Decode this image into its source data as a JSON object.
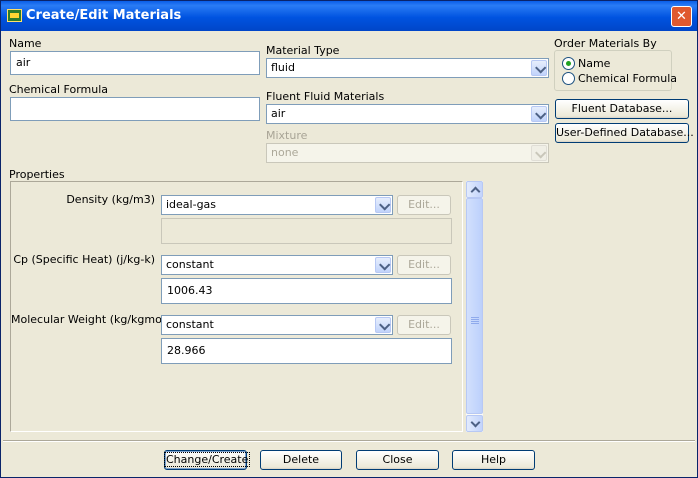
{
  "window": {
    "title": "Create/Edit Materials",
    "close_glyph": "✕"
  },
  "name": {
    "label": "Name",
    "value": "air"
  },
  "chemical_formula": {
    "label": "Chemical Formula",
    "value": ""
  },
  "material_type": {
    "label": "Material Type",
    "value": "fluid"
  },
  "fluent_fluid_materials": {
    "label": "Fluent Fluid Materials",
    "value": "air"
  },
  "mixture": {
    "label": "Mixture",
    "value": "none"
  },
  "order_by": {
    "label": "Order Materials By",
    "options": [
      {
        "label": "Name",
        "selected": true
      },
      {
        "label": "Chemical Formula",
        "selected": false
      }
    ]
  },
  "side_buttons": {
    "fluent_database": "Fluent Database...",
    "user_defined_database": "User-Defined Database..."
  },
  "properties": {
    "label": "Properties",
    "items": [
      {
        "label": "Density (kg/m3)",
        "method": "ideal-gas",
        "edit": "Edit...",
        "value": ""
      },
      {
        "label": "Cp (Specific Heat) (j/kg-k)",
        "method": "constant",
        "edit": "Edit...",
        "value": "1006.43"
      },
      {
        "label": "Molecular Weight (kg/kgmol)",
        "method": "constant",
        "edit": "Edit...",
        "value": "28.966"
      }
    ]
  },
  "footer": {
    "change_create": "Change/Create",
    "delete": "Delete",
    "close": "Close",
    "help": "Help"
  },
  "colors": {
    "title_bar": "#0053e0",
    "dialog_bg": "#ece9d8",
    "close_button": "#e0592e",
    "field_border": "#7f9db9",
    "radio_dot": "#21a121"
  },
  "icons": {
    "app": "fluent-app-icon",
    "close": "close-icon",
    "dropdown": "chevron-down-icon",
    "scroll_up": "scroll-up-icon",
    "scroll_down": "scroll-down-icon"
  }
}
